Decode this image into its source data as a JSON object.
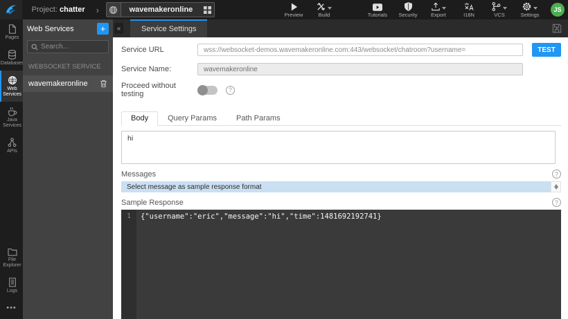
{
  "icons": {
    "help": "?",
    "collapse": "«",
    "breadcrumb_chevron": "›",
    "more": "•••",
    "plus": "+"
  },
  "colors": {
    "accent": "#2196f3",
    "avatar": "#4caf50",
    "messages_bar": "#cbdff2",
    "topbar": "#1c1c1c"
  },
  "topbar": {
    "project_label": "Project:",
    "project_name": "chatter",
    "service_tab_name": "wavemakeronline",
    "actions": {
      "preview": "Preview",
      "build": "Build",
      "tutorials": "Tutorials",
      "security": "Security",
      "export": "Export",
      "i18n": "I18N",
      "vcs": "VCS",
      "settings": "Settings"
    },
    "avatar_initials": "JS"
  },
  "sidebar": {
    "items": [
      {
        "label": "Pages"
      },
      {
        "label": "Databases"
      },
      {
        "label": "Web Services"
      },
      {
        "label": "Java Services"
      },
      {
        "label": "APIs"
      },
      {
        "label": "File Explorer"
      },
      {
        "label": "Logs"
      }
    ]
  },
  "panel": {
    "title": "Web Services",
    "search_placeholder": "Search...",
    "section_title": "WEBSOCKET SERVICE",
    "service_name": "wavemakeronline"
  },
  "main": {
    "active_tab": "Service Settings",
    "form": {
      "service_url_label": "Service URL",
      "service_url_value": "wss://websocket-demos.wavemakeronline.com:443/websocket/chatroom?username=",
      "test_button": "TEST",
      "service_name_label": "Service Name:",
      "service_name_value": "wavemakeronline",
      "proceed_label": "Proceed without testing"
    },
    "request_tabs": [
      {
        "label": "Body"
      },
      {
        "label": "Query Params"
      },
      {
        "label": "Path Params"
      }
    ],
    "body_value": "hi",
    "messages": {
      "label": "Messages",
      "select_prompt": "Select message as sample response format"
    },
    "sample_response": {
      "label": "Sample Response",
      "line_number": "1",
      "code": "{\"username\":\"eric\",\"message\":\"hi\",\"time\":1481692192741}"
    }
  }
}
